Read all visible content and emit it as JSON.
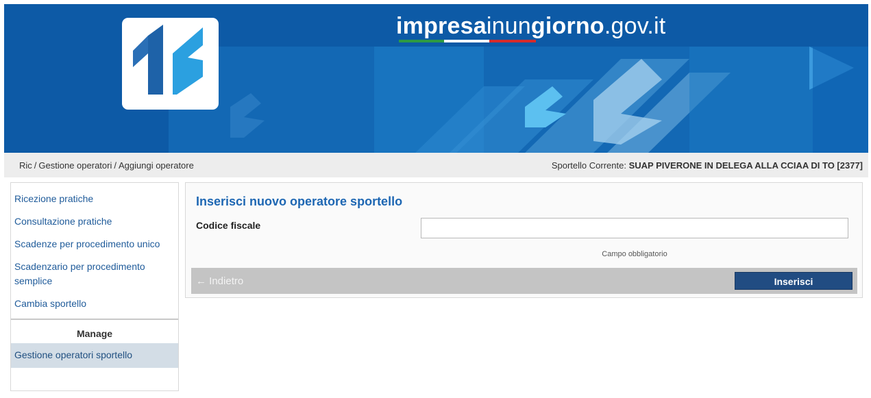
{
  "header": {
    "site_title_bold1": "impresa",
    "site_title_light1": "inun",
    "site_title_bold2": "giorno",
    "site_title_light2": ".gov.it",
    "logo_icon": "impresainungiorno-logo-icon",
    "colors": {
      "banner": "#0f5fa8",
      "flag_green": "#2e9a43",
      "flag_white": "#ffffff",
      "flag_red": "#d62b2b"
    }
  },
  "breadcrumb": {
    "items": [
      "Ric",
      "Gestione operatori",
      "Aggiungi operatore"
    ],
    "separator": "/"
  },
  "current_desk": {
    "label": "Sportello Corrente:",
    "value": "SUAP PIVERONE IN DELEGA ALLA CCIAA DI TO [2377]"
  },
  "sidebar": {
    "items": [
      {
        "label": "Ricezione pratiche"
      },
      {
        "label": "Consultazione pratiche"
      },
      {
        "label": "Scadenze per procedimento unico"
      },
      {
        "label": "Scadenzario per procedimento semplice"
      },
      {
        "label": "Cambia sportello"
      }
    ],
    "manage_heading": "Manage",
    "active_item": "Gestione operatori sportello"
  },
  "form": {
    "title": "Inserisci nuovo operatore sportello",
    "field_label": "Codice fiscale",
    "field_value": "",
    "hint": "Campo obbligatorio",
    "back_label": "← Indietro",
    "submit_label": "Inserisci"
  }
}
